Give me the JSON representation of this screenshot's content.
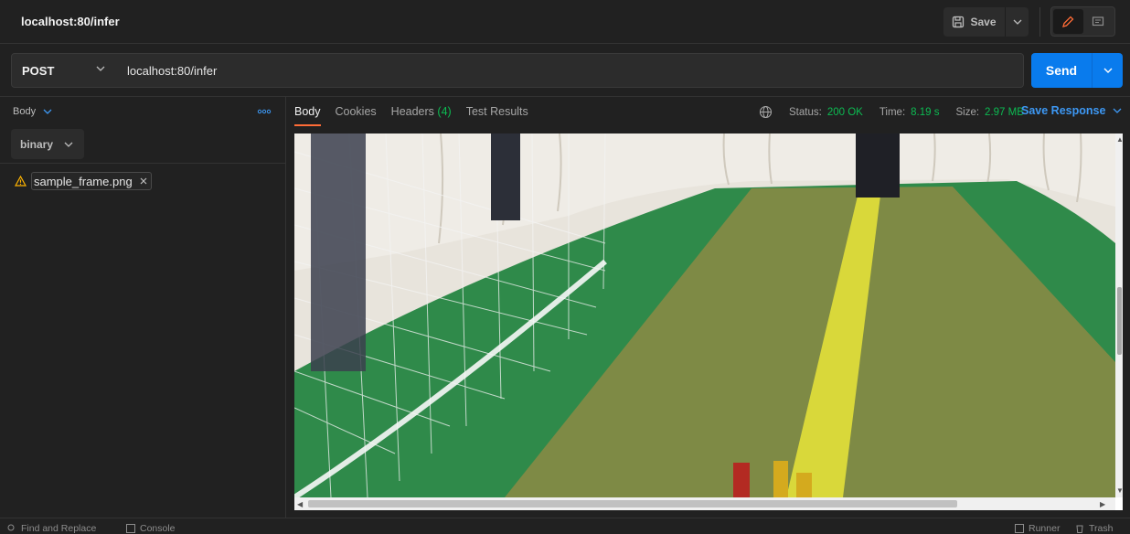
{
  "tab": {
    "title": "localhost:80/infer"
  },
  "toolbar": {
    "save_label": "Save"
  },
  "request": {
    "method": "POST",
    "url": "localhost:80/infer",
    "send_label": "Send"
  },
  "request_body": {
    "section_label": "Body",
    "mode": "binary",
    "file_name": "sample_frame.png"
  },
  "response": {
    "tabs": [
      {
        "label": "Body",
        "count": ""
      },
      {
        "label": "Cookies",
        "count": ""
      },
      {
        "label": "Headers",
        "count": "(4)"
      },
      {
        "label": "Test Results",
        "count": ""
      }
    ],
    "status_label": "Status:",
    "status_value": "200 OK",
    "time_label": "Time:",
    "time_value": "8.19 s",
    "size_label": "Size:",
    "size_value": "2.97 MB",
    "save_response_label": "Save Response"
  },
  "statusbar": {
    "find_replace": "Find and Replace",
    "console": "Console",
    "runner": "Runner",
    "trash": "Trash"
  },
  "colors": {
    "accent_orange": "#ff6c37",
    "primary_blue": "#097bed",
    "success_green": "#0cbb52",
    "warning_yellow": "#ffb400"
  }
}
